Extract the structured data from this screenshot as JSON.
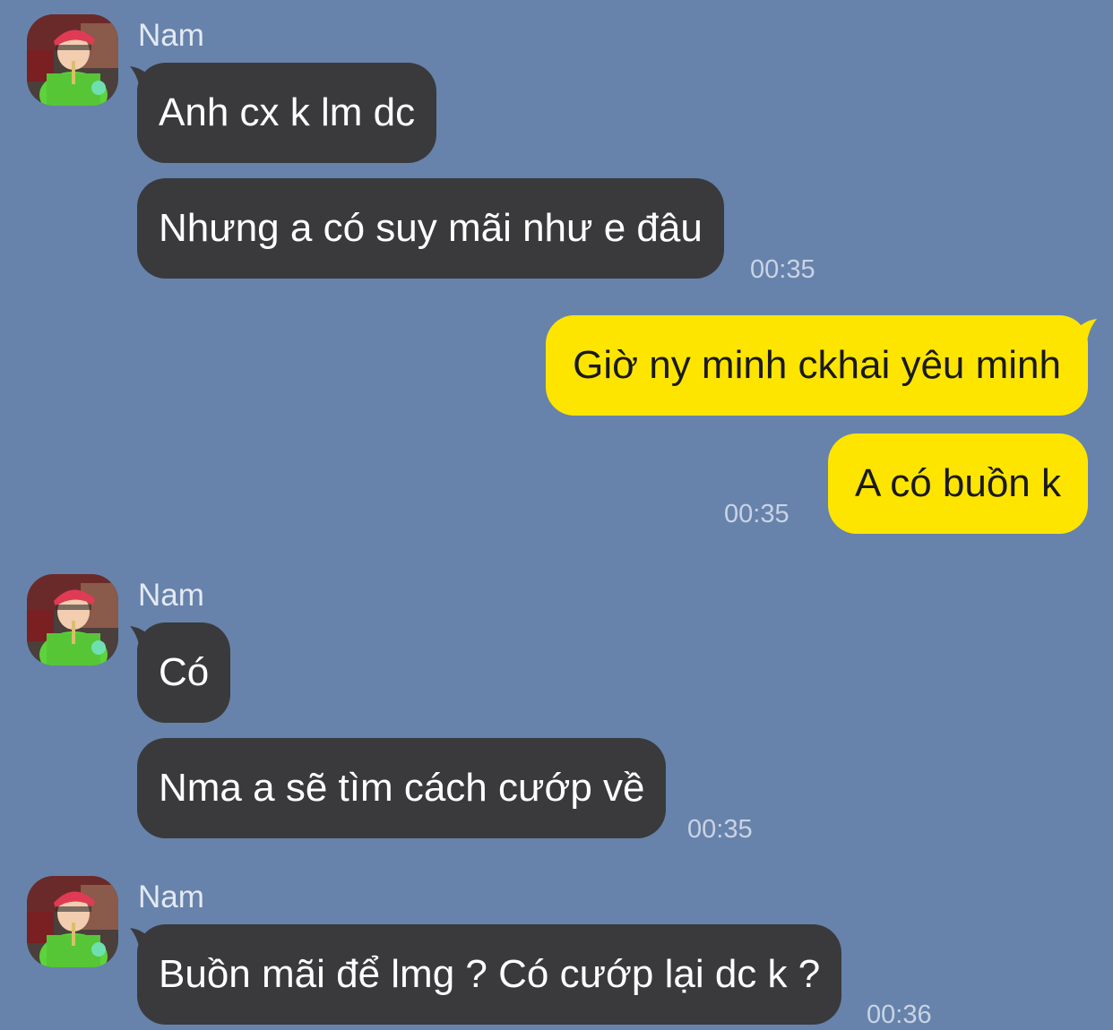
{
  "colors": {
    "background": "#6783ab",
    "incoming_bubble": "#3a3a3c",
    "outgoing_bubble": "#fee500",
    "timestamp": "#c9d3e4"
  },
  "messages": [
    {
      "sender": "Nam",
      "avatar": "profile-photo-avatar",
      "bubbles": [
        "Anh cx k lm dc",
        "Nhưng a có suy mãi như e đâu"
      ],
      "time": "00:35"
    },
    {
      "sender": "me",
      "bubbles": [
        "Giờ ny minh ckhai yêu minh",
        "A có buồn k"
      ],
      "time": "00:35"
    },
    {
      "sender": "Nam",
      "avatar": "profile-photo-avatar",
      "bubbles": [
        "Có",
        "Nma a sẽ tìm cách cướp về"
      ],
      "time": "00:35"
    },
    {
      "sender": "Nam",
      "avatar": "profile-photo-avatar",
      "bubbles": [
        "Buồn mãi để lmg ? Có cướp lại dc k ?"
      ],
      "time": "00:36"
    }
  ]
}
